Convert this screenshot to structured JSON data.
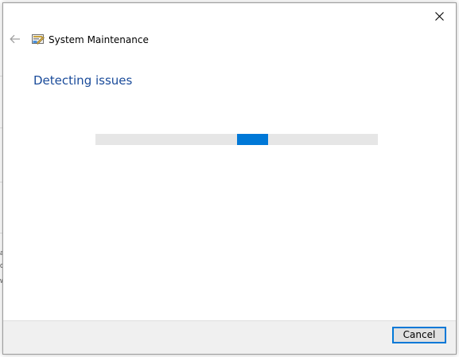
{
  "window": {
    "title": "System Maintenance",
    "icon": "system-maintenance-icon",
    "close_icon": "close-icon",
    "back_icon": "back-arrow-icon"
  },
  "main": {
    "heading": "Detecting issues",
    "progress": {
      "mode": "indeterminate",
      "segment_start_fraction": 0.5,
      "segment_width_fraction": 0.11
    }
  },
  "footer": {
    "cancel_label": "Cancel"
  },
  "colors": {
    "heading": "#1a4b9a",
    "accent": "#0078d7",
    "track": "#e6e6e6",
    "footer_bg": "#f0f0f0"
  },
  "background_glyphs": [
    "a",
    "c",
    "w"
  ]
}
